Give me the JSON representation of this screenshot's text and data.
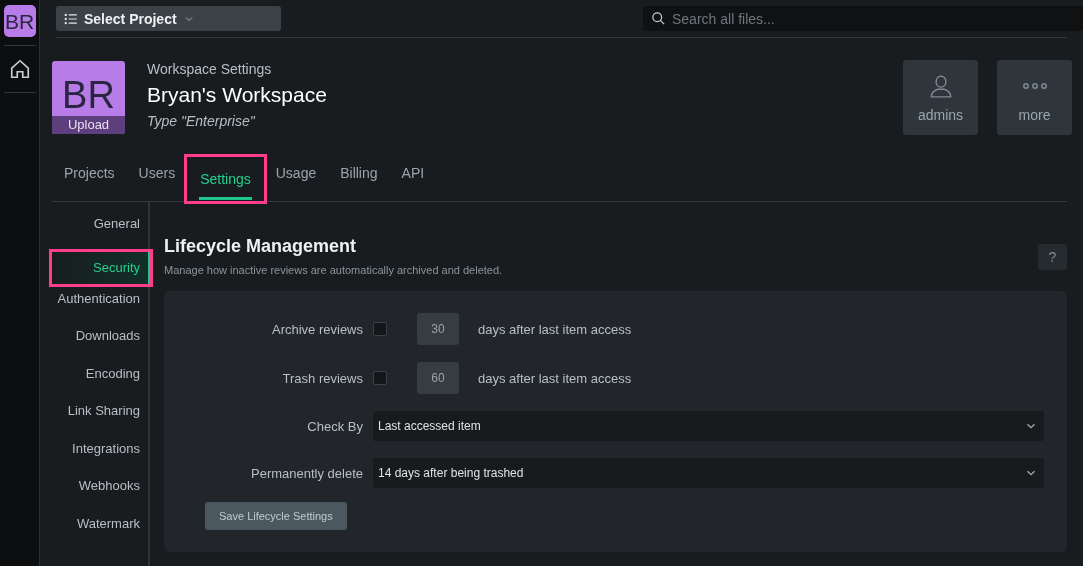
{
  "rail": {
    "avatar": "BR"
  },
  "topbar": {
    "project_button": "Select Project",
    "search": {
      "placeholder": "Search all files..."
    }
  },
  "header": {
    "avatar": {
      "initials": "BR",
      "action": "Upload"
    },
    "subtitle": "Workspace Settings",
    "title": "Bryan's Workspace",
    "type": "Type \"Enterprise\"",
    "actions": [
      {
        "label": "admins",
        "kind": "user"
      },
      {
        "label": "more",
        "kind": "more"
      }
    ]
  },
  "tabs": [
    {
      "label": "Projects",
      "selected": false,
      "highlighted": false
    },
    {
      "label": "Users",
      "selected": false,
      "highlighted": false
    },
    {
      "label": "Settings",
      "selected": true,
      "highlighted": true
    },
    {
      "label": "Usage",
      "selected": false,
      "highlighted": false
    },
    {
      "label": "Billing",
      "selected": false,
      "highlighted": false
    },
    {
      "label": "API",
      "selected": false,
      "highlighted": false
    }
  ],
  "sidebar": {
    "items": [
      {
        "label": "General",
        "selected": false,
        "highlighted": false
      },
      {
        "label": "Security",
        "selected": true,
        "highlighted": true
      },
      {
        "label": "Authentication",
        "selected": false,
        "highlighted": false
      },
      {
        "label": "Downloads",
        "selected": false,
        "highlighted": false
      },
      {
        "label": "Encoding",
        "selected": false,
        "highlighted": false
      },
      {
        "label": "Link Sharing",
        "selected": false,
        "highlighted": false
      },
      {
        "label": "Integrations",
        "selected": false,
        "highlighted": false
      },
      {
        "label": "Webhooks",
        "selected": false,
        "highlighted": false
      },
      {
        "label": "Watermark",
        "selected": false,
        "highlighted": false
      }
    ]
  },
  "section": {
    "title": "Lifecycle Management",
    "description": "Manage how inactive reviews are automatically archived and deleted.",
    "help": "?",
    "rows": [
      {
        "kind": "checkbox",
        "label": "Archive reviews",
        "checked": false,
        "disabled": true,
        "value": "30",
        "suffix": "days after last item access"
      },
      {
        "kind": "checkbox",
        "label": "Trash reviews",
        "checked": false,
        "disabled": true,
        "value": "60",
        "suffix": "days after last item access"
      },
      {
        "kind": "select",
        "label": "Check By",
        "value": "Last accessed item"
      },
      {
        "kind": "select",
        "label": "Permanently delete",
        "value": "14 days after being trashed"
      }
    ],
    "save_button": "Save Lifecycle Settings"
  }
}
